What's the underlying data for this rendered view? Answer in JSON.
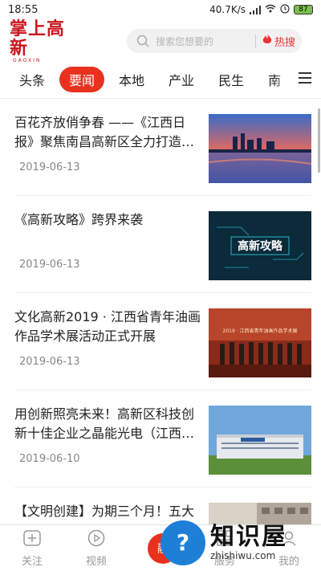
{
  "status_bar": {
    "time": "18:55",
    "network_speed": "40.7K/s",
    "battery": "87"
  },
  "header": {
    "logo_title": "掌上高新",
    "logo_subtitle": "GAOXIN",
    "search_placeholder": "搜索您想要的",
    "hot_search_label": "热搜"
  },
  "tabs": [
    {
      "label": "头条",
      "active": false
    },
    {
      "label": "要闻",
      "active": true
    },
    {
      "label": "本地",
      "active": false
    },
    {
      "label": "产业",
      "active": false
    },
    {
      "label": "民生",
      "active": false
    },
    {
      "label": "南",
      "active": false
    }
  ],
  "articles": [
    {
      "title": "百花齐放俏争春 ——《江西日报》聚焦南昌高新区全力打造…",
      "date": "2019-06-13",
      "thumb": "city-skyline-sunset"
    },
    {
      "title": "《高新攻略》跨界来袭",
      "date": "2019-06-13",
      "thumb": "gaoxin-gonglue-banner",
      "thumb_text": "高新攻略"
    },
    {
      "title": "文化高新2019 · 江西省青年油画作品学术展活动正式开展",
      "date": "2019-06-13",
      "thumb": "exhibition-group-photo",
      "thumb_text": "2019 · 江西省青年油画作品学术展"
    },
    {
      "title": "用创新照亮未来！高新区科技创新十佳企业之晶能光电（江西…",
      "date": "2019-06-10",
      "thumb": "factory-building"
    },
    {
      "title": "【文明创建】为期三个月！五大",
      "date": "",
      "thumb": "building-street"
    }
  ],
  "bottom_nav": [
    {
      "label": "关注",
      "icon": "plus-square-icon"
    },
    {
      "label": "视频",
      "icon": "play-circle-icon"
    },
    {
      "label": "融",
      "icon": "center-red-button"
    },
    {
      "label": "服务",
      "icon": "grid-icon"
    },
    {
      "label": "我的",
      "icon": "user-icon"
    }
  ],
  "watermark": {
    "title": "知识屋",
    "url": "zhishiwu.com"
  },
  "colors": {
    "brand_red": "#c8161d",
    "active_tab": "#e8321e",
    "watermark_blue": "#1e7fd6"
  }
}
